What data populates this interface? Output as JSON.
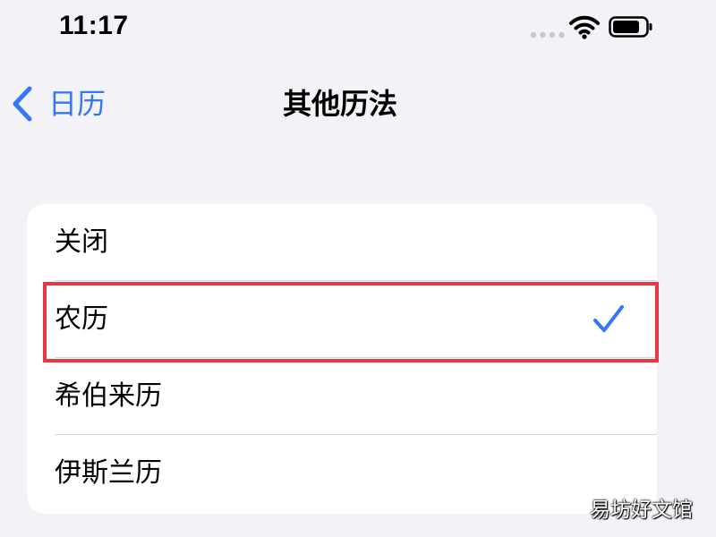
{
  "status_bar": {
    "time": "11:17",
    "icons": [
      "signal-dots-icon",
      "wifi-icon",
      "battery-icon"
    ]
  },
  "nav": {
    "back_label": "日历",
    "title": "其他历法"
  },
  "calendar_options": {
    "items": [
      {
        "label": "关闭",
        "selected": false
      },
      {
        "label": "农历",
        "selected": true
      },
      {
        "label": "希伯来历",
        "selected": false
      },
      {
        "label": "伊斯兰历",
        "selected": false
      }
    ]
  },
  "watermark": "易坊好文馆",
  "colors": {
    "accent": "#3478f6",
    "background": "#f2f2f7",
    "card": "#ffffff",
    "highlight": "#e63946"
  }
}
